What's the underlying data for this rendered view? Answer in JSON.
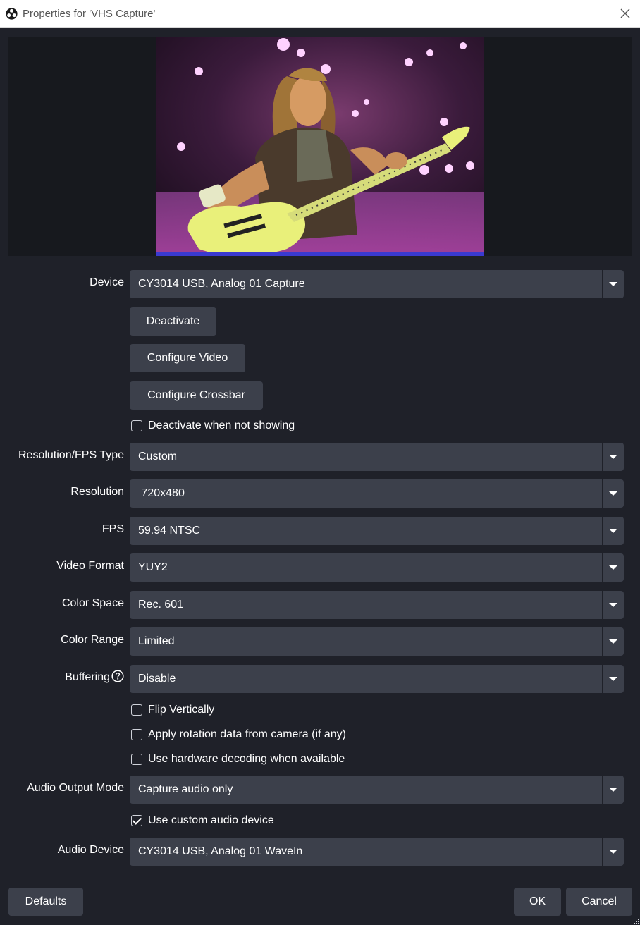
{
  "window": {
    "title": "Properties for 'VHS Capture'"
  },
  "colors": {
    "background": "#1f2129",
    "control": "#3c404b",
    "titlebar": "#ffffff"
  },
  "fields": {
    "device": {
      "label": "Device",
      "value": "CY3014 USB, Analog 01 Capture"
    },
    "res_fps_type": {
      "label": "Resolution/FPS Type",
      "value": "Custom"
    },
    "resolution": {
      "label": "Resolution",
      "value": " 720x480"
    },
    "fps": {
      "label": "FPS",
      "value": "59.94 NTSC"
    },
    "video_format": {
      "label": "Video Format",
      "value": "YUY2"
    },
    "color_space": {
      "label": "Color Space",
      "value": "Rec. 601"
    },
    "color_range": {
      "label": "Color Range",
      "value": "Limited"
    },
    "buffering": {
      "label": "Buffering",
      "value": "Disable"
    },
    "audio_output_mode": {
      "label": "Audio Output Mode",
      "value": "Capture audio only"
    },
    "audio_device": {
      "label": "Audio Device",
      "value": "CY3014 USB, Analog 01 WaveIn"
    }
  },
  "buttons": {
    "deactivate": "Deactivate",
    "configure_video": "Configure Video",
    "configure_crossbar": "Configure Crossbar",
    "defaults": "Defaults",
    "ok": "OK",
    "cancel": "Cancel"
  },
  "checkboxes": {
    "deactivate_when_not_showing": {
      "label": "Deactivate when not showing",
      "checked": false
    },
    "flip_vertically": {
      "label": "Flip Vertically",
      "checked": false
    },
    "apply_rotation": {
      "label": "Apply rotation data from camera (if any)",
      "checked": false
    },
    "hardware_decoding": {
      "label": "Use hardware decoding when available",
      "checked": false
    },
    "custom_audio_device": {
      "label": "Use custom audio device",
      "checked": true
    }
  },
  "icons": [
    "obs-logo-icon",
    "close-icon",
    "help-icon",
    "chevron-down-icon",
    "checkmark-icon",
    "resize-grip-icon"
  ]
}
